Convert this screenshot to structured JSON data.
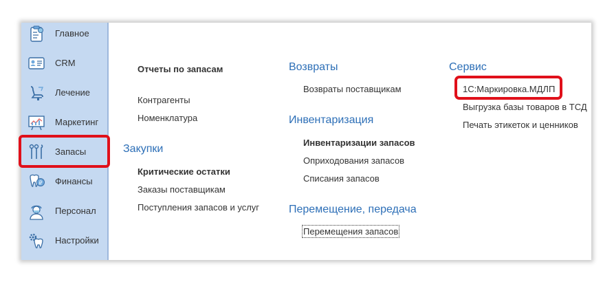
{
  "sidebar": {
    "items": [
      {
        "label": "Главное",
        "icon": "clipboard-icon"
      },
      {
        "label": "CRM",
        "icon": "contact-card-icon"
      },
      {
        "label": "Лечение",
        "icon": "dental-chair-icon"
      },
      {
        "label": "Маркетинг",
        "icon": "chart-board-icon"
      },
      {
        "label": "Запасы",
        "icon": "dental-tools-icon"
      },
      {
        "label": "Финансы",
        "icon": "tooth-coin-icon"
      },
      {
        "label": "Персонал",
        "icon": "doctor-icon"
      },
      {
        "label": "Настройки",
        "icon": "gear-tooth-icon"
      }
    ],
    "active": "Запасы"
  },
  "columns": {
    "col1": {
      "reports_heading": "Отчеты по запасам",
      "links_top": [
        "Контрагенты",
        "Номенклатура"
      ],
      "purchases_heading": "Закупки",
      "purchases_items": [
        "Критические остатки",
        "Заказы поставщикам",
        "Поступления запасов и услуг"
      ]
    },
    "col2": {
      "returns_heading": "Возвраты",
      "returns_items": [
        "Возвраты поставщикам"
      ],
      "inventory_heading": "Инвентаризация",
      "inventory_items": [
        "Инвентаризации запасов",
        "Оприходования запасов",
        "Списания запасов"
      ],
      "transfer_heading": "Перемещение, передача",
      "transfer_items": [
        "Перемещения запасов"
      ]
    },
    "col3": {
      "service_heading": "Сервис",
      "service_items": [
        "1С:Маркировка.МДЛП",
        "Выгрузка базы товаров в ТСД",
        "Печать этикеток и ценников"
      ]
    }
  },
  "colors": {
    "sidebar_bg": "#c5d9f1",
    "heading": "#2d6fb7",
    "highlight": "#e0101a"
  }
}
